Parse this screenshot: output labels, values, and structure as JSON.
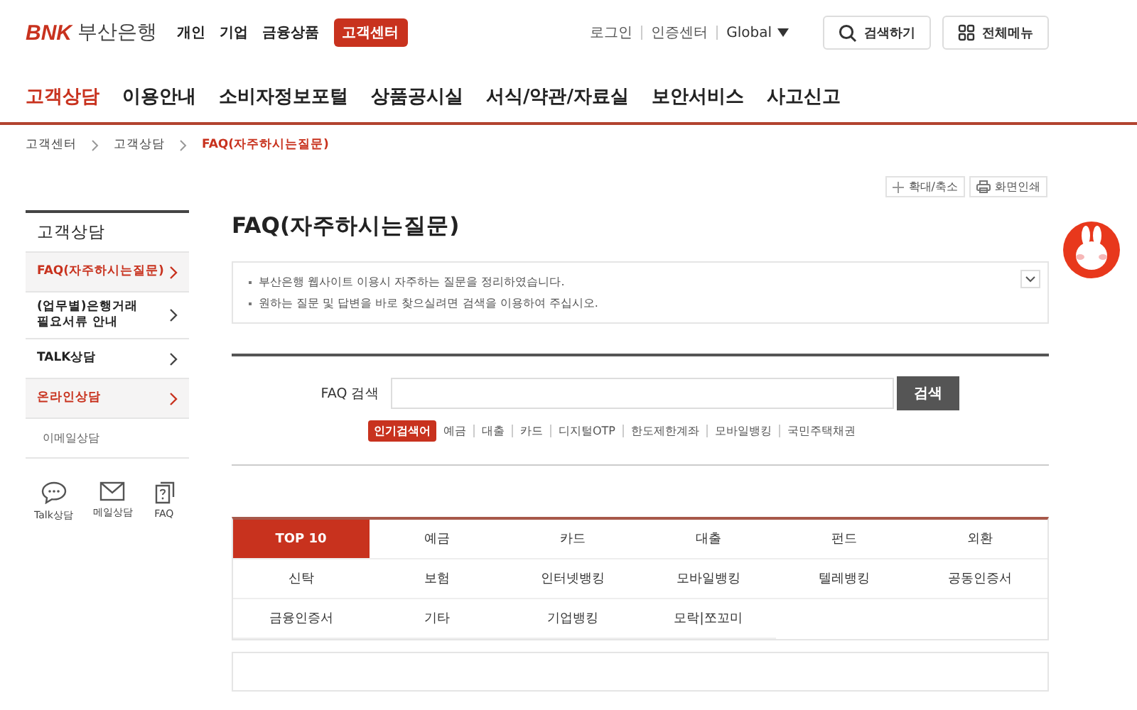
{
  "header": {
    "logo_mark": "BNK",
    "logo_text": "부산은행",
    "gnb": [
      {
        "label": "개인",
        "selected": false
      },
      {
        "label": "기업",
        "selected": false
      },
      {
        "label": "금융상품",
        "selected": false
      },
      {
        "label": "고객센터",
        "selected": true
      }
    ],
    "util_links": [
      "로그인",
      "인증센터"
    ],
    "language": "Global",
    "search_button": "검색하기",
    "menu_button": "전체메뉴"
  },
  "nav": [
    {
      "label": "고객상담",
      "selected": true
    },
    {
      "label": "이용안내",
      "selected": false
    },
    {
      "label": "소비자정보포털",
      "selected": false
    },
    {
      "label": "상품공시실",
      "selected": false
    },
    {
      "label": "서식/약관/자료실",
      "selected": false
    },
    {
      "label": "보안서비스",
      "selected": false
    },
    {
      "label": "사고신고",
      "selected": false
    }
  ],
  "breadcrumb": [
    {
      "label": "고객센터",
      "selected": false
    },
    {
      "label": "고객상담",
      "selected": false
    },
    {
      "label": "FAQ(자주하시는질문)",
      "selected": true
    }
  ],
  "tools": [
    "확대/축소",
    "화면인쇄"
  ],
  "sidebar": {
    "title": "고객상담",
    "items": [
      {
        "label": "FAQ(자주하시는질문)",
        "selected": true
      },
      {
        "label": "(업무별)은행거래\n필요서류 안내",
        "selected": false
      },
      {
        "label": "TALK상담",
        "selected": false
      },
      {
        "label": "온라인상담",
        "selected": true,
        "children": [
          {
            "label": "이메일상담"
          }
        ]
      }
    ],
    "quick": [
      {
        "kind": "talk",
        "label": "Talk상담"
      },
      {
        "kind": "mail",
        "label": "메일상담"
      },
      {
        "kind": "faq",
        "label": "FAQ"
      }
    ]
  },
  "page_title": "FAQ(자주하시는질문)",
  "notice": [
    "부산은행 웹사이트 이용시 자주하는 질문을 정리하였습니다.",
    "원하는 질문 및 답변을 바로 찾으실려면 검색을 이용하여 주십시오."
  ],
  "search": {
    "label": "FAQ 검색",
    "button": "검색",
    "keywords_label": "인기검색어",
    "keywords": [
      "예금",
      "대출",
      "카드",
      "디지털OTP",
      "한도제한계좌",
      "모바일뱅킹",
      "국민주택채권"
    ]
  },
  "tabs": [
    {
      "label": "TOP 10",
      "selected": true
    },
    {
      "label": "예금",
      "selected": false
    },
    {
      "label": "카드",
      "selected": false
    },
    {
      "label": "대출",
      "selected": false
    },
    {
      "label": "펀드",
      "selected": false
    },
    {
      "label": "외환",
      "selected": false
    },
    {
      "label": "신탁",
      "selected": false
    },
    {
      "label": "보험",
      "selected": false
    },
    {
      "label": "인터넷뱅킹",
      "selected": false
    },
    {
      "label": "모바일뱅킹",
      "selected": false
    },
    {
      "label": "텔레뱅킹",
      "selected": false
    },
    {
      "label": "공동인증서",
      "selected": false
    },
    {
      "label": "금융인증서",
      "selected": false
    },
    {
      "label": "기타",
      "selected": false
    },
    {
      "label": "기업뱅킹",
      "selected": false
    },
    {
      "label": "모락|쪼꼬미",
      "selected": false
    }
  ]
}
